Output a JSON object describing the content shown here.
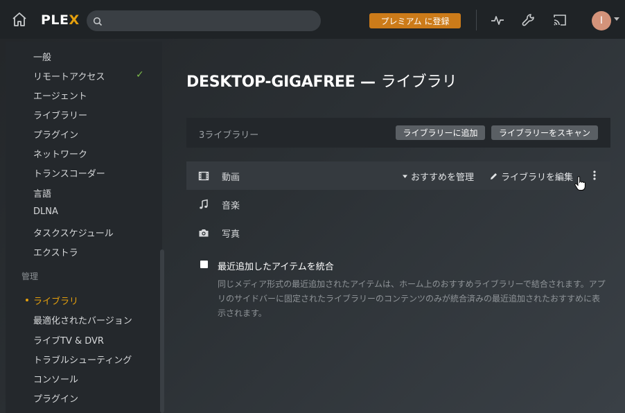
{
  "topbar": {
    "logo_text": "PLE",
    "logo_x": "X",
    "search_placeholder": "",
    "premium_label": "プレミアム に登録",
    "avatar_initial": "I",
    "icons": [
      "home-icon",
      "search-icon",
      "activity-icon",
      "wrench-icon",
      "cast-icon"
    ]
  },
  "sidebar": {
    "items_top": [
      {
        "label": "一般"
      },
      {
        "label": "リモートアクセス"
      },
      {
        "label": "エージェント"
      },
      {
        "label": "ライブラリー"
      },
      {
        "label": "プラグイン"
      },
      {
        "label": "ネットワーク"
      },
      {
        "label": "トランスコーダー"
      },
      {
        "label": "言語"
      },
      {
        "label": "DLNA"
      },
      {
        "label": "タスクスケジュール"
      },
      {
        "label": "エクストラ"
      }
    ],
    "section_label": "管理",
    "items_manage": [
      {
        "label": "ライブラリ"
      },
      {
        "label": "最適化されたバージョン"
      },
      {
        "label": "ライブTV & DVR"
      },
      {
        "label": "トラブルシューティング"
      },
      {
        "label": "コンソール"
      },
      {
        "label": "プラグイン"
      }
    ],
    "checkmark": "✓"
  },
  "main": {
    "title_host": "DESKTOP-GIGAFREE",
    "title_sep": " — ",
    "title_suffix": "ライブラリ",
    "library_count": "3ライブラリー",
    "add_library_label": "ライブラリーに追加",
    "scan_library_label": "ライブラリーをスキャン",
    "libraries": [
      {
        "label": "動画",
        "icon": "film-icon"
      },
      {
        "label": "音楽",
        "icon": "music-icon"
      },
      {
        "label": "写真",
        "icon": "camera-icon"
      }
    ],
    "manage_recommended_label": "おすすめを管理",
    "edit_library_label": "ライブラリを編集",
    "option_label": "最近追加したアイテムを統合",
    "option_description": "同じメディア形式の最近追加されたアイテムは、ホーム上のおすすめライブラリーで結合されます。アプリのサイドバーに固定されたライブラリーのコンテンツのみが統合済みの最近追加されたおすすめに表示されます。"
  }
}
